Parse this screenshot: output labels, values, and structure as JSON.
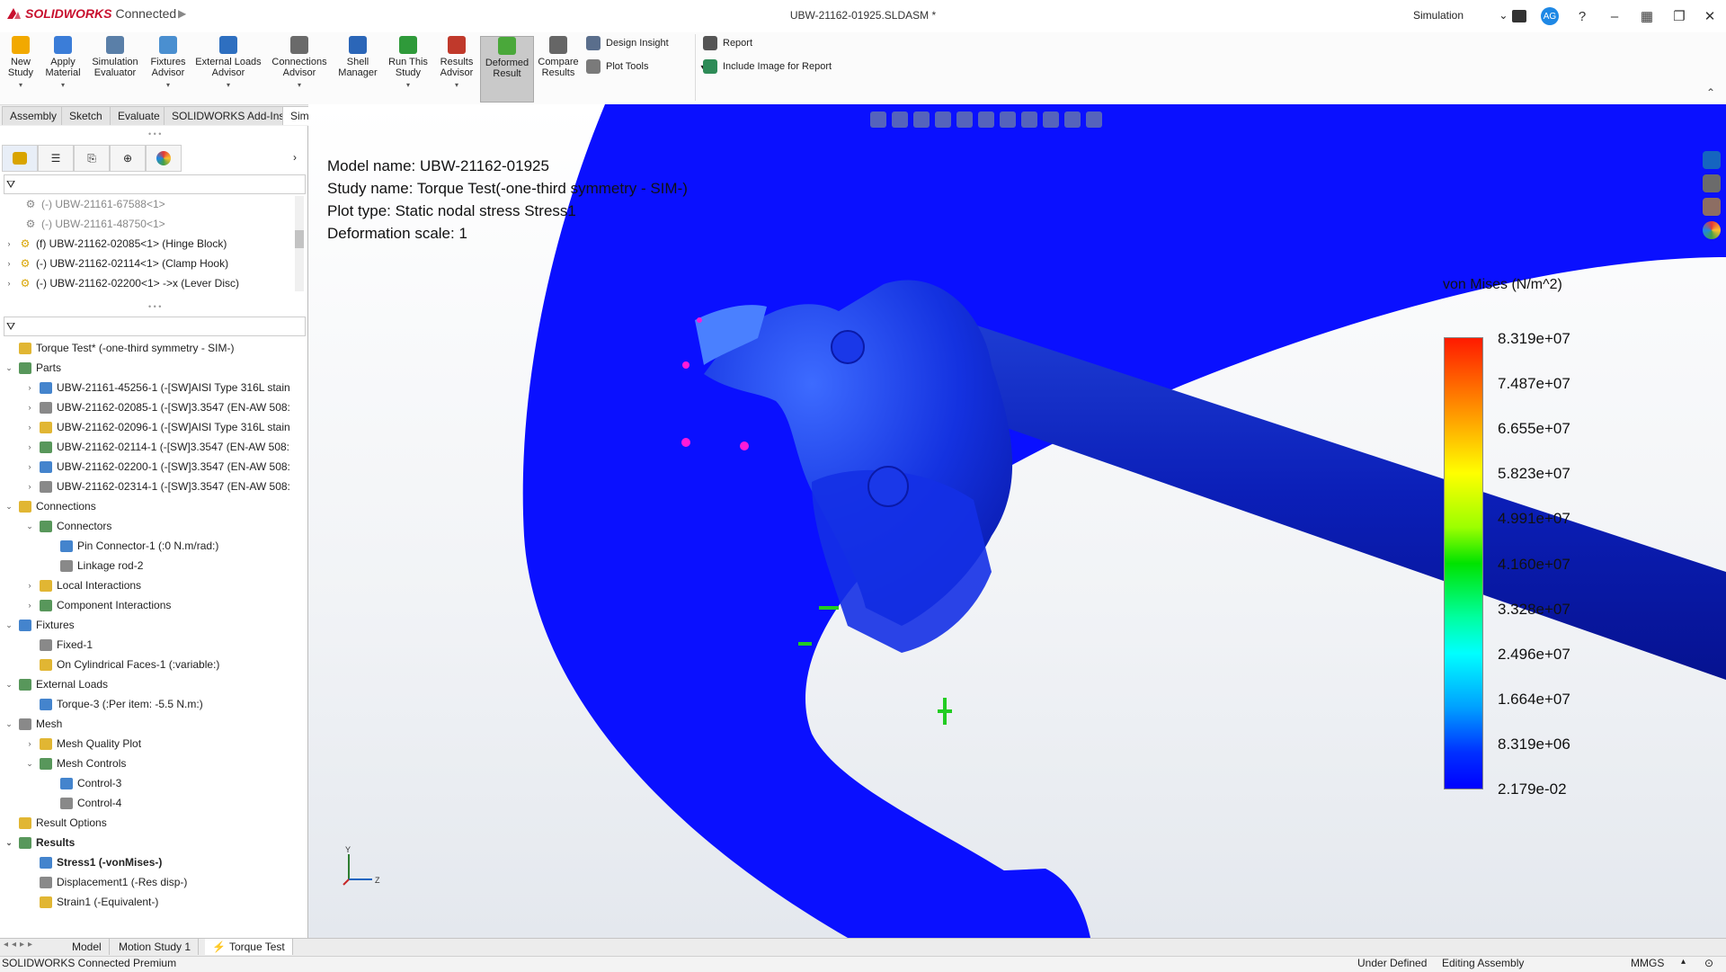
{
  "app": {
    "brand": "SOLIDWORKS",
    "brand_suffix": "Connected",
    "document_title": "UBW-21162-01925.SLDASM *"
  },
  "titlebar": {
    "workspace": "Simulation",
    "user_initials": "AG",
    "icons": [
      "terminal-icon",
      "help-icon",
      "minimize-icon",
      "grid-icon",
      "restore-icon",
      "close-icon"
    ]
  },
  "ribbon": {
    "buttons": [
      {
        "label": "New Study",
        "color": "#f2a900"
      },
      {
        "label": "Apply Material",
        "color": "#3b7dd8"
      },
      {
        "label": "Simulation Evaluator",
        "color": "#5a7fa8"
      },
      {
        "label": "Fixtures Advisor",
        "color": "#4a8fd0"
      },
      {
        "label": "External Loads Advisor",
        "color": "#2e6fc0"
      },
      {
        "label": "Connections Advisor",
        "color": "#6a6a6a"
      },
      {
        "label": "Shell Manager",
        "color": "#2b66b8"
      },
      {
        "label": "Run This Study",
        "color": "#2f9a3a"
      },
      {
        "label": "Results Advisor",
        "color": "#c0392b"
      },
      {
        "label": "Deformed Result",
        "color": "#4aa83a"
      },
      {
        "label": "Compare Results",
        "color": "#666666"
      }
    ],
    "small_buttons": [
      {
        "label": "Design Insight"
      },
      {
        "label": "Plot Tools"
      },
      {
        "label": "Report"
      },
      {
        "label": "Include Image for Report"
      }
    ]
  },
  "command_tabs": [
    "Assembly",
    "Sketch",
    "Evaluate",
    "SOLIDWORKS Add-Ins",
    "Simulation"
  ],
  "feature_tree_top": [
    {
      "label": "(-) UBW-21161-67588<1>",
      "dim": true
    },
    {
      "label": "(-) UBW-21161-48750<1>",
      "dim": true
    },
    {
      "label": "(f) UBW-21162-02085<1> (Hinge Block)",
      "dim": false
    },
    {
      "label": "(-) UBW-21162-02114<1> (Clamp Hook)",
      "dim": false
    },
    {
      "label": "(-) UBW-21162-02200<1> ->x (Lever Disc)",
      "dim": false
    }
  ],
  "study_tree": [
    {
      "label": "Torque Test* (-one-third symmetry - SIM-)",
      "level": 0,
      "exp": ""
    },
    {
      "label": "Parts",
      "level": 0,
      "exp": "v"
    },
    {
      "label": "UBW-21161-45256-1 (-[SW]AISI Type 316L stain",
      "level": 1,
      "exp": ">"
    },
    {
      "label": "UBW-21162-02085-1 (-[SW]3.3547 (EN-AW 508:",
      "level": 1,
      "exp": ">"
    },
    {
      "label": "UBW-21162-02096-1 (-[SW]AISI Type 316L stain",
      "level": 1,
      "exp": ">"
    },
    {
      "label": "UBW-21162-02114-1 (-[SW]3.3547 (EN-AW 508:",
      "level": 1,
      "exp": ">"
    },
    {
      "label": "UBW-21162-02200-1 (-[SW]3.3547 (EN-AW 508:",
      "level": 1,
      "exp": ">"
    },
    {
      "label": "UBW-21162-02314-1 (-[SW]3.3547 (EN-AW 508:",
      "level": 1,
      "exp": ">"
    },
    {
      "label": "Connections",
      "level": 0,
      "exp": "v"
    },
    {
      "label": "Connectors",
      "level": 1,
      "exp": "v"
    },
    {
      "label": "Pin Connector-1 (:0 N.m/rad:)",
      "level": 2,
      "exp": ""
    },
    {
      "label": "Linkage rod-2",
      "level": 2,
      "exp": ""
    },
    {
      "label": "Local Interactions",
      "level": 1,
      "exp": ">"
    },
    {
      "label": "Component Interactions",
      "level": 1,
      "exp": ">"
    },
    {
      "label": "Fixtures",
      "level": 0,
      "exp": "v"
    },
    {
      "label": "Fixed-1",
      "level": 1,
      "exp": ""
    },
    {
      "label": "On Cylindrical Faces-1 (:variable:)",
      "level": 1,
      "exp": ""
    },
    {
      "label": "External Loads",
      "level": 0,
      "exp": "v"
    },
    {
      "label": "Torque-3 (:Per item: -5.5 N.m:)",
      "level": 1,
      "exp": ""
    },
    {
      "label": "Mesh",
      "level": 0,
      "exp": "v"
    },
    {
      "label": "Mesh Quality Plot",
      "level": 1,
      "exp": ">"
    },
    {
      "label": "Mesh Controls",
      "level": 1,
      "exp": "v"
    },
    {
      "label": "Control-3",
      "level": 2,
      "exp": ""
    },
    {
      "label": "Control-4",
      "level": 2,
      "exp": ""
    },
    {
      "label": "Result Options",
      "level": 0,
      "exp": ""
    },
    {
      "label": "Results",
      "level": 0,
      "exp": "v",
      "bold": true
    },
    {
      "label": "Stress1 (-vonMises-)",
      "level": 1,
      "exp": "",
      "bold": true
    },
    {
      "label": "Displacement1 (-Res disp-)",
      "level": 1,
      "exp": ""
    },
    {
      "label": "Strain1 (-Equivalent-)",
      "level": 1,
      "exp": ""
    }
  ],
  "plot_info": {
    "model": "Model name: UBW-21162-01925",
    "study": "Study name: Torque Test(-one-third symmetry - SIM-)",
    "type": "Plot type: Static nodal stress Stress1",
    "scale": "Deformation scale: 1"
  },
  "legend": {
    "title": "von Mises (N/m^2)",
    "labels": [
      "8.319e+07",
      "7.487e+07",
      "6.655e+07",
      "5.823e+07",
      "4.991e+07",
      "4.160e+07",
      "3.328e+07",
      "2.496e+07",
      "1.664e+07",
      "8.319e+06",
      "2.179e-02"
    ]
  },
  "triad": {
    "y": "Y",
    "z": "Z"
  },
  "model_tabs": [
    "Model",
    "Motion Study 1",
    "Torque Test"
  ],
  "status": {
    "left": "SOLIDWORKS Connected Premium",
    "state": "Under Defined",
    "mode": "Editing Assembly",
    "units": "MMGS"
  }
}
